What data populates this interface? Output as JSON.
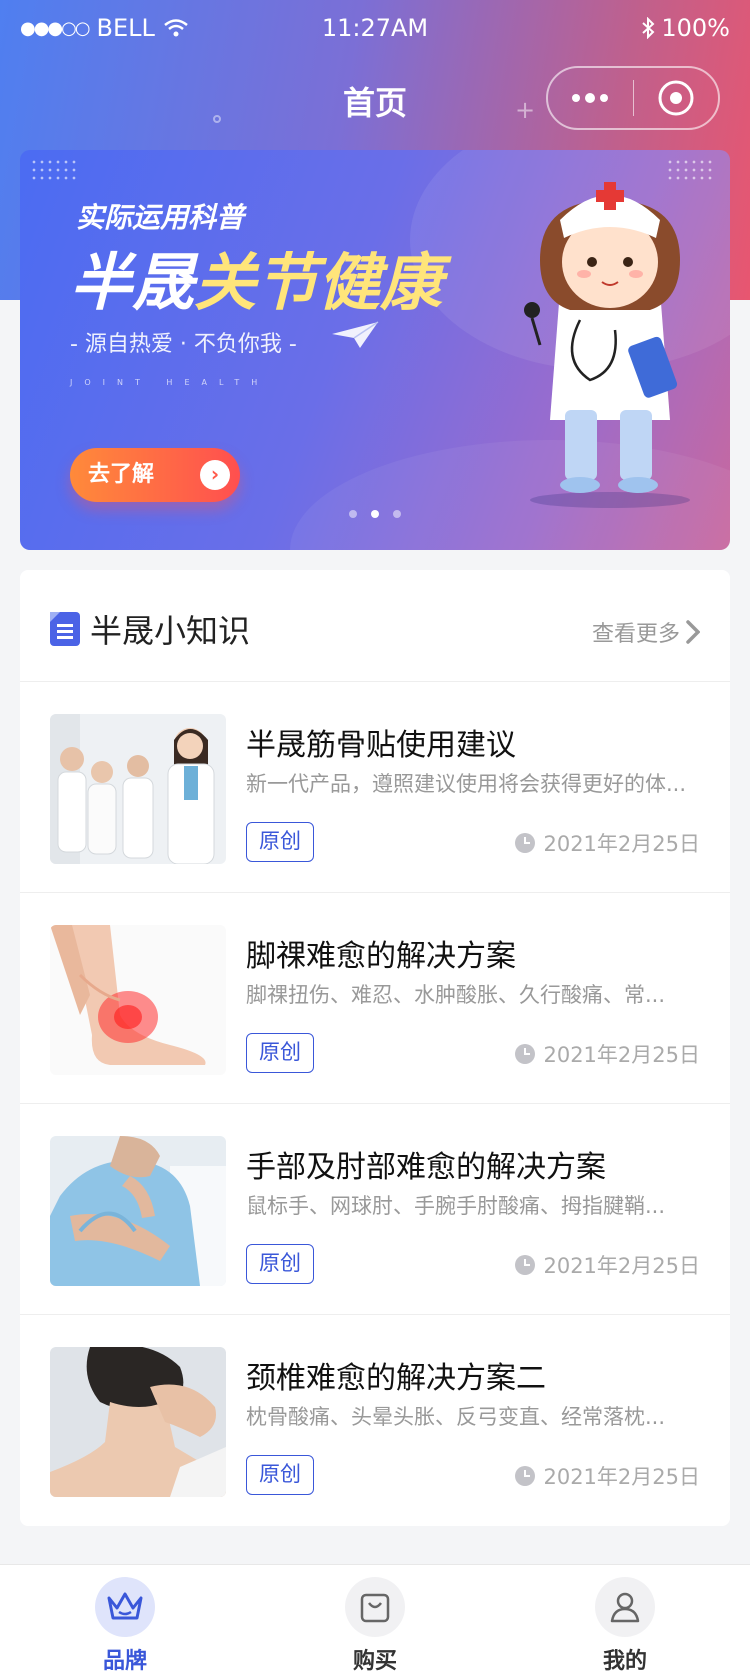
{
  "status_bar": {
    "carrier": "BELL",
    "time": "11:27AM",
    "battery": "100%"
  },
  "nav": {
    "title": "首页"
  },
  "banner": {
    "subtitle": "实际运用科普",
    "title_part1": "半晟",
    "title_part2": "关节健康",
    "slogan": "- 源自热爱 · 不负你我 -",
    "english": "JOINT HEALTH",
    "button_label": "去了解",
    "slides_count": 3,
    "active_slide": 2
  },
  "knowledge": {
    "title": "半晟小知识",
    "more_label": "查看更多",
    "articles": [
      {
        "title": "半晟筋骨贴使用建议",
        "desc": "新一代产品，遵照建议使用将会获得更好的体...",
        "tag": "原创",
        "date": "2021年2月25日",
        "image": "doctors-team"
      },
      {
        "title": "脚祼难愈的解决方案",
        "desc": "脚祼扭伤、难忍、水肿酸胀、久行酸痛、常...",
        "tag": "原创",
        "date": "2021年2月25日",
        "image": "ankle-pain"
      },
      {
        "title": "手部及肘部难愈的解决方案",
        "desc": "鼠标手、网球肘、手腕手肘酸痛、拇指腱鞘...",
        "tag": "原创",
        "date": "2021年2月25日",
        "image": "elbow-pain"
      },
      {
        "title": "颈椎难愈的解决方案二",
        "desc": "枕骨酸痛、头晕头胀、反弓变直、经常落枕...",
        "tag": "原创",
        "date": "2021年2月25日",
        "image": "neck-pain"
      }
    ]
  },
  "tabbar": {
    "tabs": [
      {
        "label": "品牌",
        "icon": "crown-icon",
        "active": true
      },
      {
        "label": "购买",
        "icon": "shopping-bag-icon",
        "active": false
      },
      {
        "label": "我的",
        "icon": "user-icon",
        "active": false
      }
    ]
  },
  "colors": {
    "accent": "#3a57d9",
    "banner_button": "#ff5a4a",
    "title_highlight": "#ffe57a"
  }
}
